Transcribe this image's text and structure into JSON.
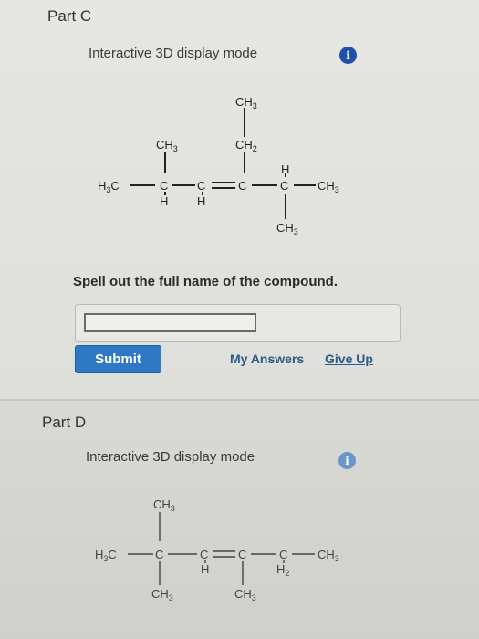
{
  "part_c": {
    "title": "Part C",
    "mode_label": "Interactive 3D display mode",
    "info_glyph": "i",
    "badge_color": "#1f4fa8",
    "structure": {
      "top_ch3": "CH",
      "top_ch3_sub": "3",
      "ch2": "CH",
      "ch2_sub": "2",
      "left_ch3": "CH",
      "left_ch3_sub": "3",
      "h3c": "H",
      "h3c_sub": "3",
      "h3c_c": "C",
      "c1": "C",
      "c2": "C",
      "c3": "C",
      "c4": "C",
      "h_under_c1": "H",
      "h_under_c2": "H",
      "h_above_c4": "H",
      "right_ch3": "CH",
      "right_ch3_sub": "3",
      "bottom_ch3": "CH",
      "bottom_ch3_sub": "3"
    },
    "question": "Spell out the full name of the compound.",
    "answer_value": "",
    "submit_label": "Submit",
    "my_answers_label": "My Answers",
    "give_up_label": "Give Up"
  },
  "part_d": {
    "title": "Part D",
    "mode_label": "Interactive 3D display mode",
    "info_glyph": "i",
    "badge_color": "#6a97c8",
    "structure": {
      "top_ch3": "CH",
      "top_ch3_sub": "3",
      "h3c": "H",
      "h3c_sub": "3",
      "h3c_c": "C",
      "c1": "C",
      "c2": "C",
      "c3": "C",
      "c4": "C",
      "h_under_c2": "H",
      "h2_under_c4": "H",
      "h2_under_c4_sub": "2",
      "right_ch3": "CH",
      "right_ch3_sub": "3",
      "bottom_ch3_c1": "CH",
      "bottom_ch3_c1_sub": "3",
      "bottom_ch3_c3": "CH",
      "bottom_ch3_c3_sub": "3"
    }
  }
}
